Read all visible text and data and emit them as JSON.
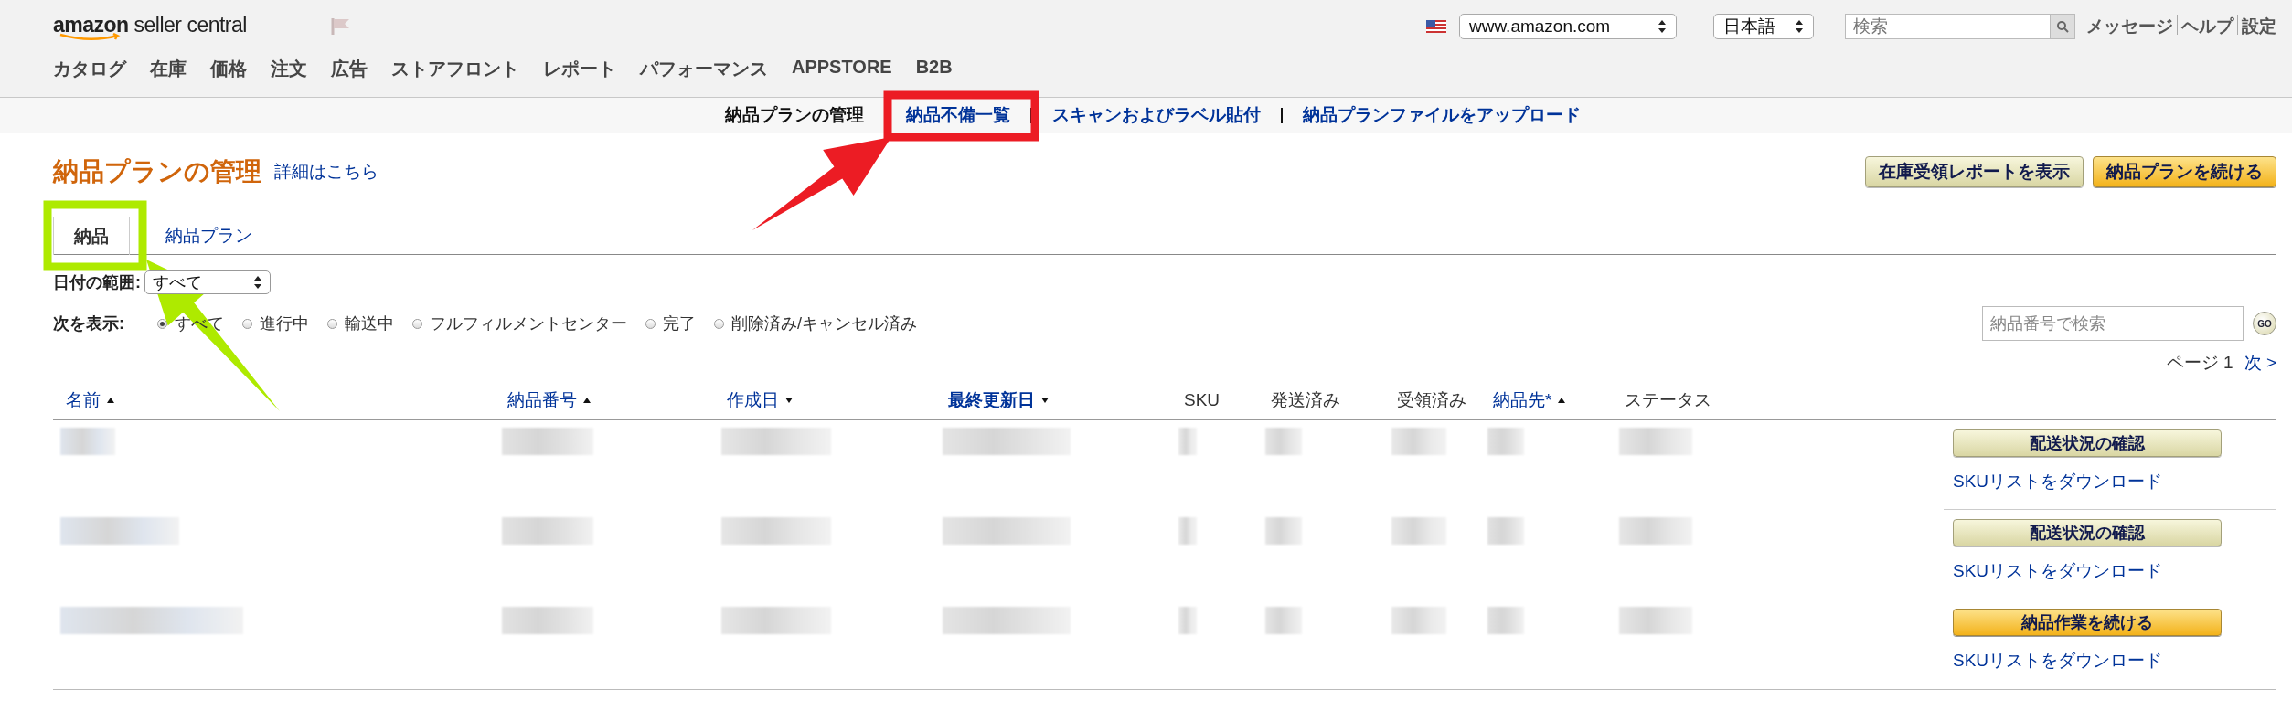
{
  "header": {
    "logo": "**amazon** seller central",
    "marketplace": "www.amazon.com",
    "language": "日本語",
    "search": {
      "placeholder": "検索"
    },
    "links": [
      "メッセージ",
      "ヘルプ",
      "設定"
    ]
  },
  "nav": [
    "カタログ",
    "在庫",
    "価格",
    "注文",
    "広告",
    "ストアフロント",
    "レポート",
    "パフォーマンス",
    "APPSTORE",
    "B2B"
  ],
  "subnav": [
    {
      "label": "納品プランの管理",
      "selected": true
    },
    {
      "label": "納品不備一覧",
      "selected": false
    },
    {
      "label": "スキャンおよびラベル貼付",
      "selected": false
    },
    {
      "label": "納品プランファイルをアップロード",
      "selected": false
    }
  ],
  "page": {
    "title": "納品プランの管理",
    "help_link": "詳細はこちら",
    "buttons": [
      {
        "label": "在庫受領レポートを表示",
        "kind": "secondary"
      },
      {
        "label": "納品プランを続ける",
        "kind": "primary"
      }
    ]
  },
  "tabs": [
    {
      "label": "納品",
      "selected": true
    },
    {
      "label": "納品プラン",
      "selected": false
    }
  ],
  "date_range": {
    "label": "日付の範囲:",
    "value": "すべて"
  },
  "filter": {
    "label": "次を表示:",
    "options": [
      {
        "label": "すべて",
        "selected": true
      },
      {
        "label": "進行中",
        "selected": false
      },
      {
        "label": "輸送中",
        "selected": false
      },
      {
        "label": "フルフィルメントセンター",
        "selected": false
      },
      {
        "label": "完了",
        "selected": false
      },
      {
        "label": "削除済み/キャンセル済み",
        "selected": false
      }
    ]
  },
  "shipment_search": {
    "placeholder": "納品番号で検索",
    "button": "GO"
  },
  "pagination": {
    "page": "ページ 1",
    "next": "次 >"
  },
  "table": {
    "columns": [
      {
        "label": "名前",
        "sortable": true,
        "ascending": true,
        "selected": false
      },
      {
        "label": "納品番号",
        "sortable": true,
        "ascending": true,
        "selected": false
      },
      {
        "label": "作成日",
        "sortable": true,
        "ascending": false,
        "selected": false
      },
      {
        "label": "最終更新日",
        "sortable": true,
        "ascending": false,
        "selected": true
      },
      {
        "label": "SKU",
        "sortable": false,
        "selected": false
      },
      {
        "label": "発送済み",
        "sortable": false,
        "selected": false
      },
      {
        "label": "受領済み",
        "sortable": false,
        "selected": false
      },
      {
        "label": "納品先*",
        "sortable": true,
        "ascending": true,
        "selected": false
      },
      {
        "label": "ステータス",
        "sortable": false,
        "selected": false
      }
    ],
    "rows": [
      {
        "action": {
          "label": "配送状況の確認",
          "kind": "secondary"
        },
        "link": "SKUリストをダウンロード"
      },
      {
        "action": {
          "label": "配送状況の確認",
          "kind": "secondary"
        },
        "link": "SKUリストをダウンロード"
      },
      {
        "action": {
          "label": "納品作業を続ける",
          "kind": "primary"
        },
        "link": "SKUリストをダウンロード"
      }
    ]
  },
  "annotations": [
    {
      "kind": "box",
      "color": "#ec1c24"
    },
    {
      "kind": "arrow",
      "color": "#ec1c24"
    },
    {
      "kind": "box",
      "color": "#aeea00"
    },
    {
      "kind": "arrow",
      "color": "#aeea00"
    }
  ]
}
